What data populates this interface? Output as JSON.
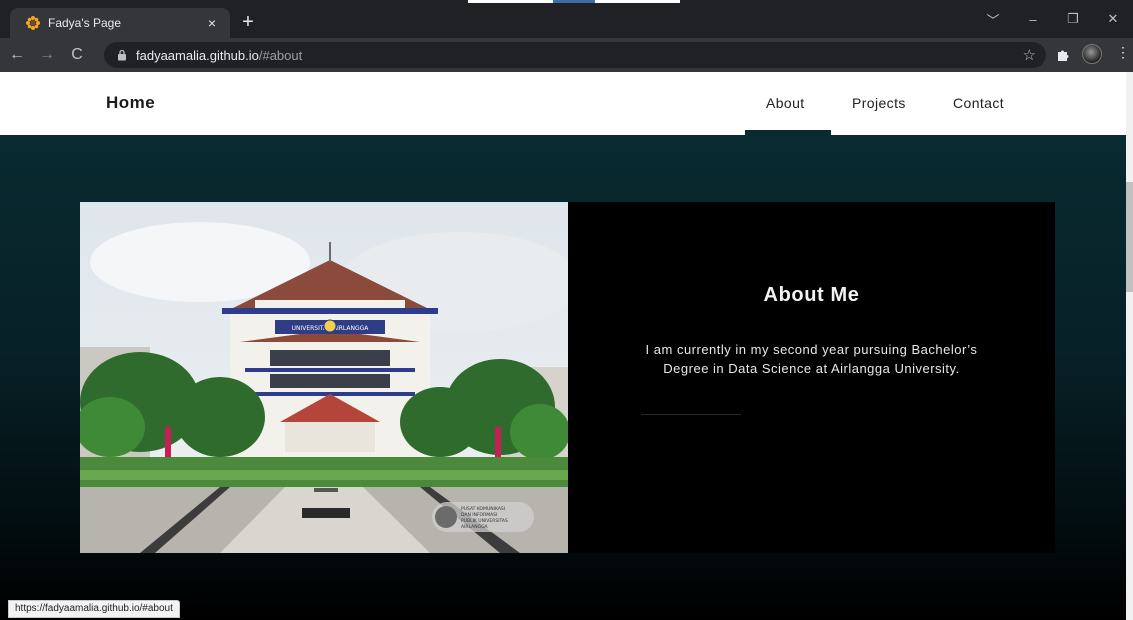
{
  "browser": {
    "tab_title": "Fadya's Page",
    "tab_close": "×",
    "new_tab": "+",
    "url_host": "fadyaamalia.github.io",
    "url_path": "/#about",
    "status_url": "https://fadyaamalia.github.io/#about",
    "icons": {
      "favicon": "sunflower-icon",
      "back": "back-arrow-icon",
      "forward": "forward-arrow-icon",
      "reload": "reload-icon",
      "lock": "lock-icon",
      "bookmark": "star-icon",
      "extensions": "puzzle-icon",
      "profile": "avatar",
      "menu": "kebab-menu-icon"
    }
  },
  "nav": {
    "brand": "Home",
    "links": [
      {
        "label": "About",
        "active": true
      },
      {
        "label": "Projects",
        "active": false
      },
      {
        "label": "Contact",
        "active": false
      }
    ]
  },
  "about": {
    "title": "About Me",
    "text": "I am currently in my second year pursuing Bachelor’s Degree in Data Science at Airlangga University.",
    "photo_watermark": [
      "PUSAT KOMUNIKASI",
      "DAN INFORMASI",
      "PUBLIK UNIVERSITAS",
      "AIRLANGGA"
    ],
    "photo_banner": "UNIVERSITAS AIRLANGGA"
  },
  "colors": {
    "section_top": "#082a31",
    "section_bottom": "#000000",
    "card_bg": "#000000",
    "nav_bg": "#ffffff",
    "active_underline": "#0b2a30"
  }
}
